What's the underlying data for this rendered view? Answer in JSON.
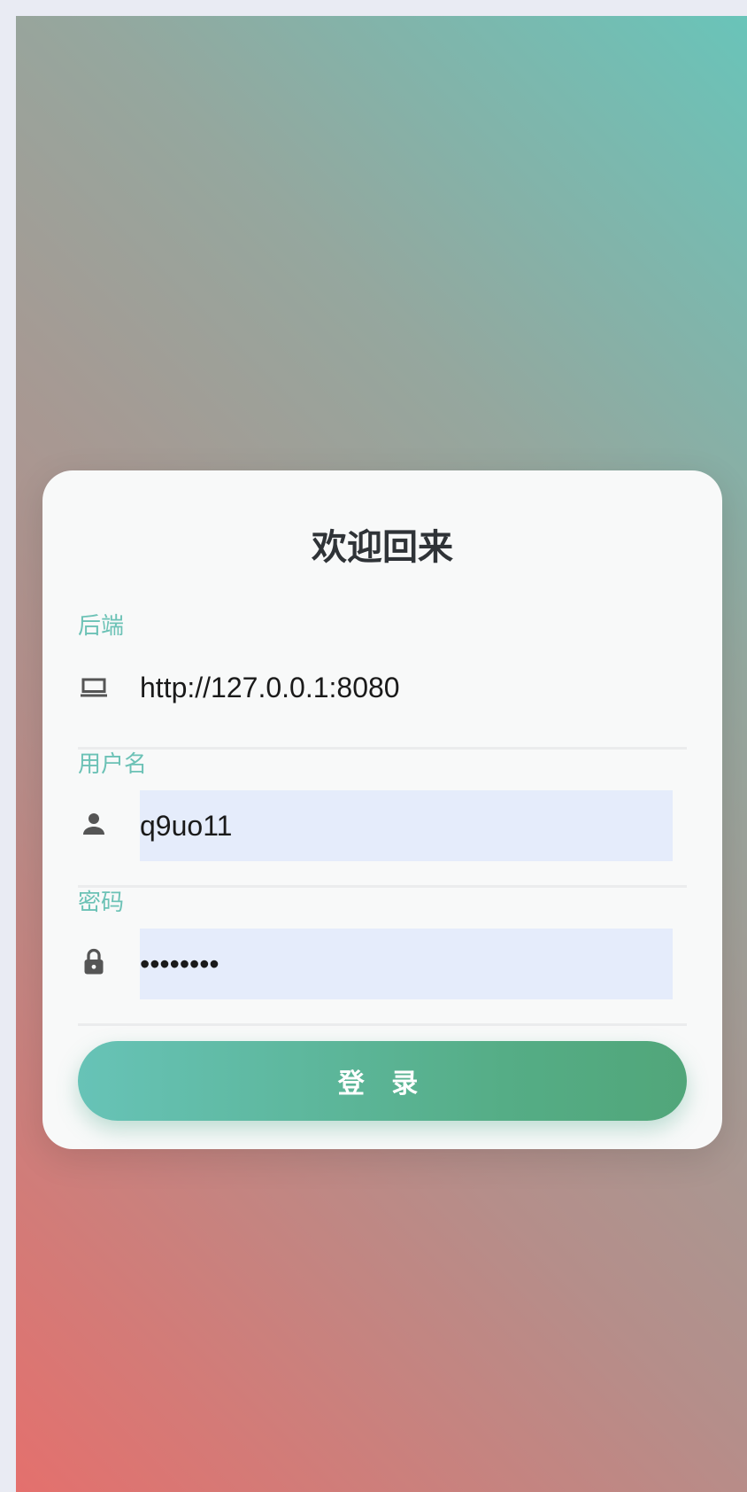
{
  "login": {
    "title": "欢迎回来",
    "backend": {
      "label": "后端",
      "value": "http://127.0.0.1:8080",
      "icon": "laptop-icon"
    },
    "username": {
      "label": "用户名",
      "value": "q9uo11",
      "icon": "person-icon"
    },
    "password": {
      "label": "密码",
      "value": "password",
      "icon": "lock-icon"
    },
    "submit_label": "登 录"
  },
  "colors": {
    "label": "#6cc2b6",
    "button_start": "#67c3b7",
    "button_end": "#51a67a",
    "autofill": "#e5ecfb"
  }
}
